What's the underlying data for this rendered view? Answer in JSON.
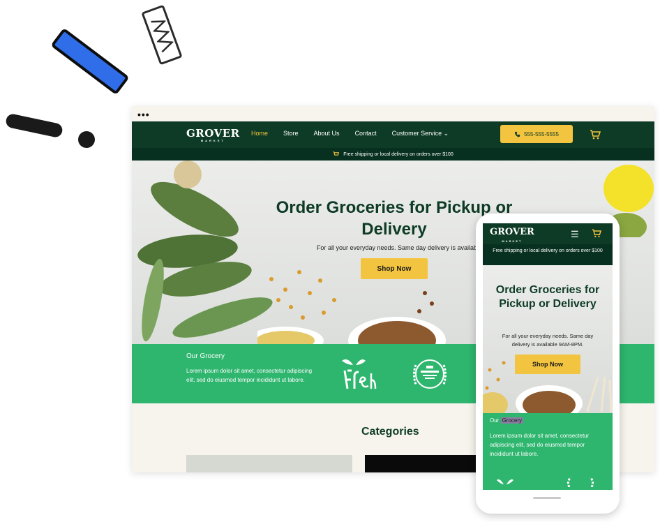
{
  "brand": {
    "name": "GROVER",
    "tagline": "MARKET"
  },
  "colors": {
    "primary": "#0e3b26",
    "accent": "#f3c43f",
    "green": "#2eb56e"
  },
  "desktop": {
    "window_dots": "•••",
    "nav": [
      {
        "label": "Home",
        "active": true
      },
      {
        "label": "Store"
      },
      {
        "label": "About Us"
      },
      {
        "label": "Contact"
      },
      {
        "label": "Customer Service ⌄"
      }
    ],
    "phone_button": "555-555-5555",
    "shipping_notice": "Free shipping or local delivery on orders over $100",
    "hero": {
      "title": "Order Groceries for Pickup or Delivery",
      "subtitle": "For all your everyday needs. Same day delivery is availab",
      "cta": "Shop Now"
    },
    "grocery": {
      "heading": "Our Grocery",
      "text": "Lorem ipsum dolor sit amet, consectetur adipiscing elit, sed do eiusmod tempor incididunt ut labore."
    },
    "categories_title": "Categories"
  },
  "mobile": {
    "menu_icon": "☰",
    "shipping_notice": "Free shipping or local delivery on orders over $100",
    "hero": {
      "title": "Order Groceries for Pickup or Delivery",
      "subtitle": "For all your everyday needs. Same day delivery is available 9AM-8PM.",
      "cta": "Shop Now"
    },
    "grocery": {
      "heading_prefix": "Our ",
      "heading_highlight": "Grocery",
      "text": "Lorem ipsum dolor sit amet, consectetur adipiscing elit, sed do eiusmod tempor incididunt ut labore."
    }
  }
}
